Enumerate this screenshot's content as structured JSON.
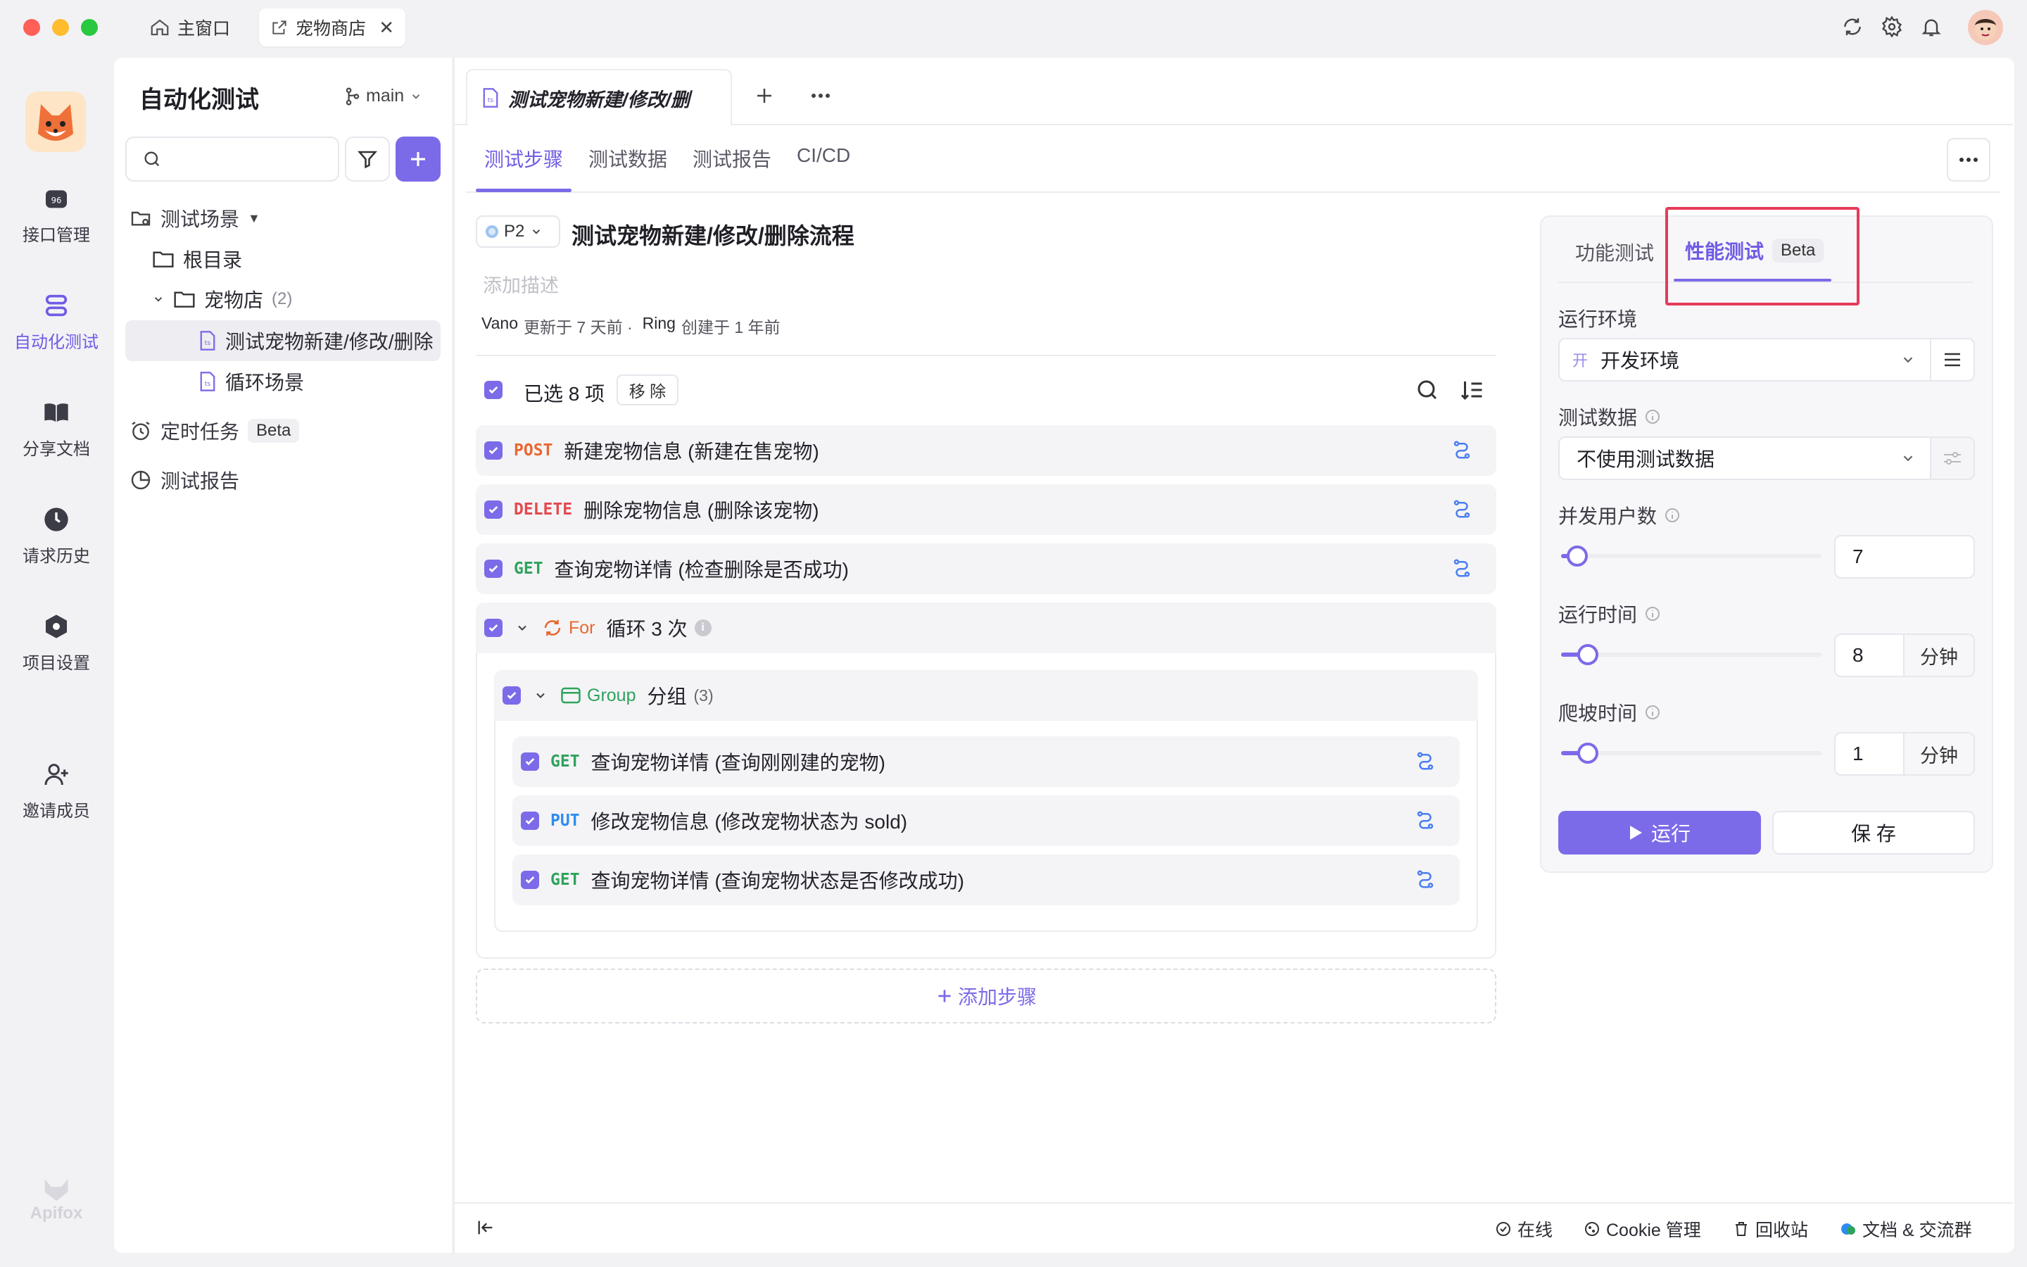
{
  "window": {
    "tabs": [
      {
        "label": "主窗口"
      },
      {
        "label": "宠物商店"
      }
    ]
  },
  "nav": {
    "items": [
      {
        "label": "接口管理"
      },
      {
        "label": "自动化测试"
      },
      {
        "label": "分享文档"
      },
      {
        "label": "请求历史"
      },
      {
        "label": "项目设置"
      },
      {
        "label": "邀请成员"
      }
    ],
    "brand": "Apifox"
  },
  "sidebar": {
    "title": "自动化测试",
    "branch": "main",
    "search_placeholder": "",
    "scenes_label": "测试场景",
    "root_label": "根目录",
    "folder_label": "宠物店",
    "folder_count": "(2)",
    "scene_items": [
      "测试宠物新建/修改/删除",
      "循环场景"
    ],
    "scheduled_label": "定时任务",
    "beta_label": "Beta",
    "reports_label": "测试报告"
  },
  "editor_tab": {
    "label": "测试宠物新建/修改/删"
  },
  "content_tabs": [
    "测试步骤",
    "测试数据",
    "测试报告",
    "CI/CD"
  ],
  "scenario": {
    "priority": "P2",
    "title": "测试宠物新建/修改/删除流程",
    "description_placeholder": "添加描述",
    "meta_user1": "Vano",
    "meta_text1": "更新于 7 天前 ·",
    "meta_user2": "Ring",
    "meta_text2": "创建于 1 年前",
    "selected_text": "已选 8 项",
    "remove_label": "移 除"
  },
  "steps": [
    {
      "method": "POST",
      "text": "新建宠物信息 (新建在售宠物)",
      "color": "#e8672f"
    },
    {
      "method": "DELETE",
      "text": "删除宠物信息 (删除该宠物)",
      "color": "#e5484d"
    },
    {
      "method": "GET",
      "text": "查询宠物详情 (检查删除是否成功)",
      "color": "#2ea35b"
    }
  ],
  "loop": {
    "keyword": "For",
    "text": "循环 3 次",
    "color": "#e8672f"
  },
  "group": {
    "keyword": "Group",
    "text": "分组",
    "count": "(3)",
    "color": "#2ea35b"
  },
  "group_steps": [
    {
      "method": "GET",
      "text": "查询宠物详情 (查询刚刚建的宠物)",
      "color": "#2ea35b"
    },
    {
      "method": "PUT",
      "text": "修改宠物信息 (修改宠物状态为 sold)",
      "color": "#2d8cf0"
    },
    {
      "method": "GET",
      "text": "查询宠物详情 (查询宠物状态是否修改成功)",
      "color": "#2ea35b"
    }
  ],
  "add_step_label": "添加步骤",
  "run_panel": {
    "tabs": [
      "功能测试",
      "性能测试"
    ],
    "beta": "Beta",
    "env_label": "运行环境",
    "env_badge": "开",
    "env_value": "开发环境",
    "data_label": "测试数据",
    "data_value": "不使用测试数据",
    "users_label": "并发用户数",
    "users_value": "7",
    "users_level": 0.04,
    "duration_label": "运行时间",
    "duration_value": "8",
    "duration_level": 0.08,
    "duration_unit": "分钟",
    "rampup_label": "爬坡时间",
    "rampup_value": "1",
    "rampup_level": 0.08,
    "rampup_unit": "分钟",
    "run_label": "运行",
    "save_label": "保 存"
  },
  "statusbar": {
    "online": "在线",
    "cookie": "Cookie 管理",
    "trash": "回收站",
    "docs": "文档 & 交流群"
  },
  "colors": {
    "accent": "#7b6be8",
    "highlight_box": "#e63b5a"
  }
}
